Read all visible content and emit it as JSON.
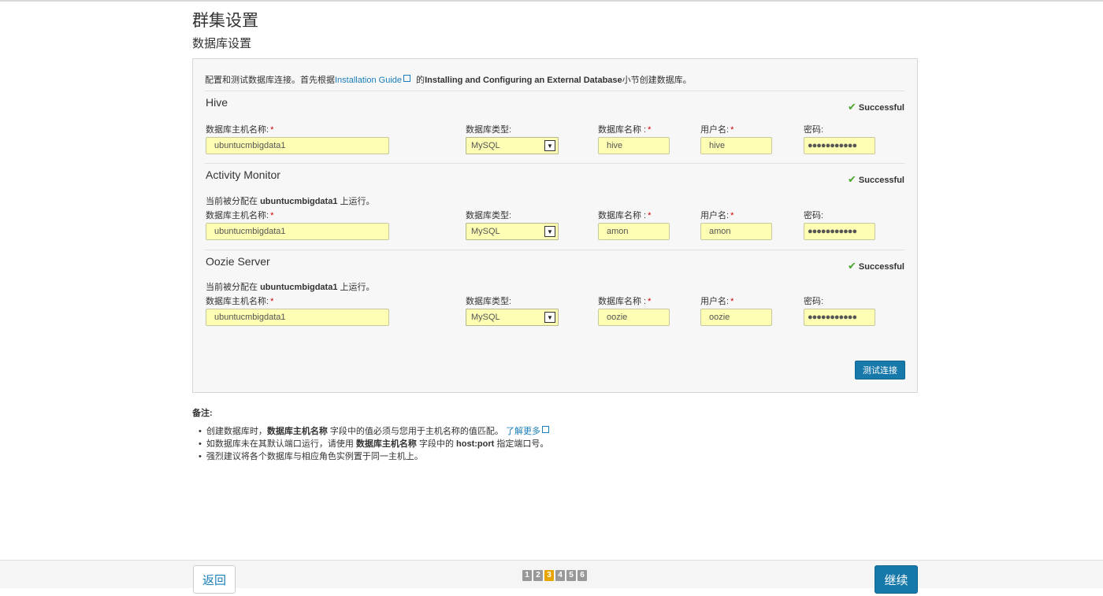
{
  "header": {
    "title": "群集设置",
    "subtitle": "数据库设置"
  },
  "intro": {
    "prefix": "配置和测试数据库连接。首先根据",
    "link": "Installation Guide",
    "middle": " 的",
    "bold": "Installing and Configuring an External Database",
    "suffix": "小节创建数据库。"
  },
  "labels": {
    "host": "数据库主机名称:",
    "type": "数据库类型:",
    "dbname": "数据库名称 :",
    "user": "用户名:",
    "password": "密码:",
    "required": "*",
    "assigned_prefix": "当前被分配在 ",
    "assigned_suffix": " 上运行。"
  },
  "sections": [
    {
      "title": "Hive",
      "status": "Successful",
      "host": "ubuntucmbigdata1",
      "type": "MySQL",
      "dbname": "hive",
      "user": "hive",
      "password": "●●●●●●●●●●●",
      "assigned_host": ""
    },
    {
      "title": "Activity Monitor",
      "status": "Successful",
      "host": "ubuntucmbigdata1",
      "type": "MySQL",
      "dbname": "amon",
      "user": "amon",
      "password": "●●●●●●●●●●●",
      "assigned_host": "ubuntucmbigdata1"
    },
    {
      "title": "Oozie Server",
      "status": "Successful",
      "host": "ubuntucmbigdata1",
      "type": "MySQL",
      "dbname": "oozie",
      "user": "oozie",
      "password": "●●●●●●●●●●●",
      "assigned_host": "ubuntucmbigdata1"
    }
  ],
  "test_button": "测试连接",
  "notes": {
    "title": "备注:",
    "item1_a": "创建数据库时，",
    "item1_b": "数据库主机名称",
    "item1_c": " 字段中的值必须与您用于主机名称的值匹配。 ",
    "item1_link": "了解更多",
    "item2_a": "如数据库未在其默认端口运行，请使用 ",
    "item2_b": "数据库主机名称",
    "item2_c": " 字段中的 ",
    "item2_d": "host:port",
    "item2_e": " 指定端口号。",
    "item3": "强烈建议将各个数据库与相应角色实例置于同一主机上。"
  },
  "footer": {
    "back": "返回",
    "next": "继续",
    "steps": [
      "1",
      "2",
      "3",
      "4",
      "5",
      "6"
    ],
    "current_step": "3"
  },
  "colors": {
    "accent": "#1778aa",
    "success": "#4aa52e",
    "input_bg": "#fdfdb4",
    "active_step": "#e8a400"
  },
  "icons": {
    "success": "check-icon",
    "external": "external-link-icon",
    "select": "chevron-down-icon"
  }
}
